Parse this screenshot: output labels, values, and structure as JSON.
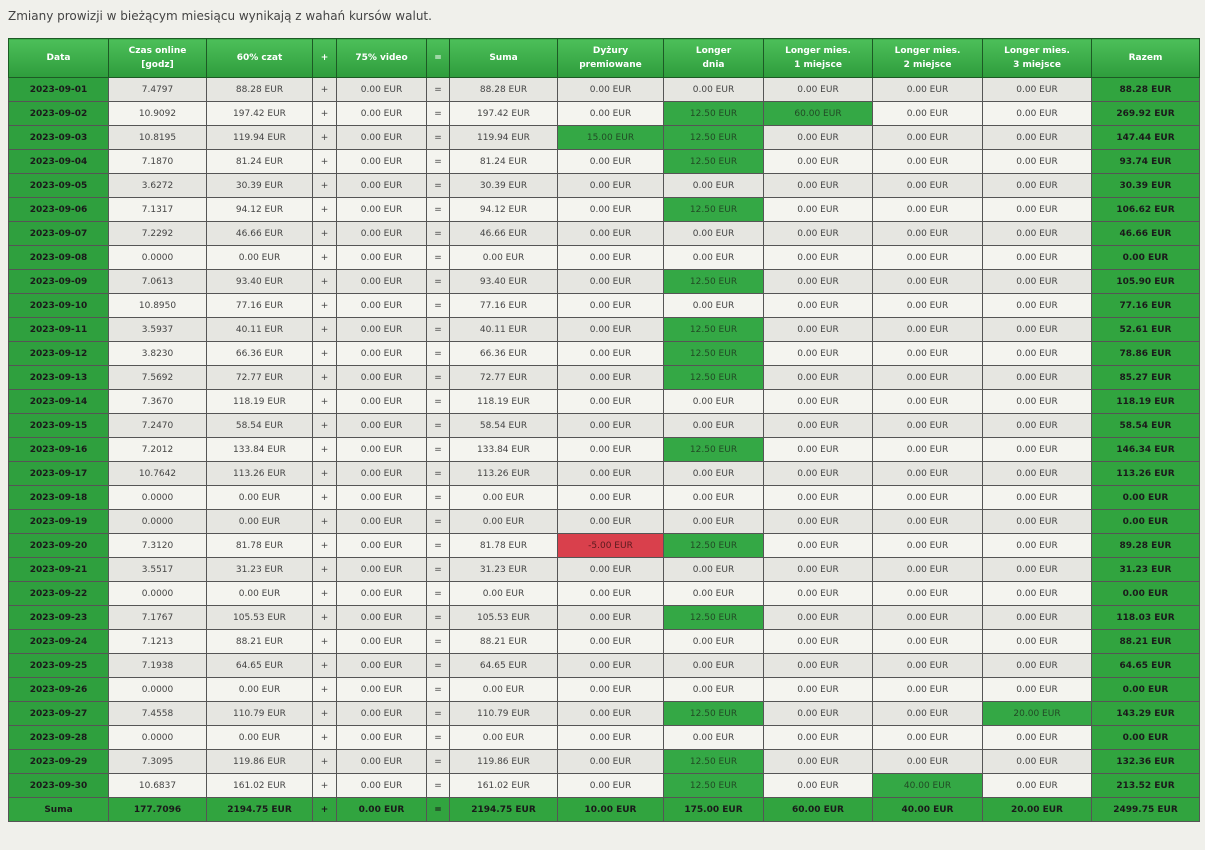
{
  "notice": "Zmiany prowizji w bieżącym miesiącu wynikają z wahań kursów walut.",
  "headers": [
    [
      "Data"
    ],
    [
      "Czas online",
      "[godz]"
    ],
    [
      "60% czat"
    ],
    [
      "+"
    ],
    [
      "75% video"
    ],
    [
      "="
    ],
    [
      "Suma"
    ],
    [
      "Dyżury",
      "premiowane"
    ],
    [
      "Longer",
      "dnia"
    ],
    [
      "Longer mies.",
      "1 miejsce"
    ],
    [
      "Longer mies.",
      "2 miejsce"
    ],
    [
      "Longer mies.",
      "3 miejsce"
    ],
    [
      "Razem"
    ]
  ],
  "rows": [
    [
      "2023-09-01",
      "7.4797",
      "88.28 EUR",
      "+",
      "0.00 EUR",
      "=",
      "88.28 EUR",
      "0.00 EUR",
      "0.00 EUR",
      "0.00 EUR",
      "0.00 EUR",
      "0.00 EUR",
      "88.28 EUR"
    ],
    [
      "2023-09-02",
      "10.9092",
      "197.42 EUR",
      "+",
      "0.00 EUR",
      "=",
      "197.42 EUR",
      "0.00 EUR",
      "12.50 EUR",
      "60.00 EUR",
      "0.00 EUR",
      "0.00 EUR",
      "269.92 EUR"
    ],
    [
      "2023-09-03",
      "10.8195",
      "119.94 EUR",
      "+",
      "0.00 EUR",
      "=",
      "119.94 EUR",
      "15.00 EUR",
      "12.50 EUR",
      "0.00 EUR",
      "0.00 EUR",
      "0.00 EUR",
      "147.44 EUR"
    ],
    [
      "2023-09-04",
      "7.1870",
      "81.24 EUR",
      "+",
      "0.00 EUR",
      "=",
      "81.24 EUR",
      "0.00 EUR",
      "12.50 EUR",
      "0.00 EUR",
      "0.00 EUR",
      "0.00 EUR",
      "93.74 EUR"
    ],
    [
      "2023-09-05",
      "3.6272",
      "30.39 EUR",
      "+",
      "0.00 EUR",
      "=",
      "30.39 EUR",
      "0.00 EUR",
      "0.00 EUR",
      "0.00 EUR",
      "0.00 EUR",
      "0.00 EUR",
      "30.39 EUR"
    ],
    [
      "2023-09-06",
      "7.1317",
      "94.12 EUR",
      "+",
      "0.00 EUR",
      "=",
      "94.12 EUR",
      "0.00 EUR",
      "12.50 EUR",
      "0.00 EUR",
      "0.00 EUR",
      "0.00 EUR",
      "106.62 EUR"
    ],
    [
      "2023-09-07",
      "7.2292",
      "46.66 EUR",
      "+",
      "0.00 EUR",
      "=",
      "46.66 EUR",
      "0.00 EUR",
      "0.00 EUR",
      "0.00 EUR",
      "0.00 EUR",
      "0.00 EUR",
      "46.66 EUR"
    ],
    [
      "2023-09-08",
      "0.0000",
      "0.00 EUR",
      "+",
      "0.00 EUR",
      "=",
      "0.00 EUR",
      "0.00 EUR",
      "0.00 EUR",
      "0.00 EUR",
      "0.00 EUR",
      "0.00 EUR",
      "0.00 EUR"
    ],
    [
      "2023-09-09",
      "7.0613",
      "93.40 EUR",
      "+",
      "0.00 EUR",
      "=",
      "93.40 EUR",
      "0.00 EUR",
      "12.50 EUR",
      "0.00 EUR",
      "0.00 EUR",
      "0.00 EUR",
      "105.90 EUR"
    ],
    [
      "2023-09-10",
      "10.8950",
      "77.16 EUR",
      "+",
      "0.00 EUR",
      "=",
      "77.16 EUR",
      "0.00 EUR",
      "0.00 EUR",
      "0.00 EUR",
      "0.00 EUR",
      "0.00 EUR",
      "77.16 EUR"
    ],
    [
      "2023-09-11",
      "3.5937",
      "40.11 EUR",
      "+",
      "0.00 EUR",
      "=",
      "40.11 EUR",
      "0.00 EUR",
      "12.50 EUR",
      "0.00 EUR",
      "0.00 EUR",
      "0.00 EUR",
      "52.61 EUR"
    ],
    [
      "2023-09-12",
      "3.8230",
      "66.36 EUR",
      "+",
      "0.00 EUR",
      "=",
      "66.36 EUR",
      "0.00 EUR",
      "12.50 EUR",
      "0.00 EUR",
      "0.00 EUR",
      "0.00 EUR",
      "78.86 EUR"
    ],
    [
      "2023-09-13",
      "7.5692",
      "72.77 EUR",
      "+",
      "0.00 EUR",
      "=",
      "72.77 EUR",
      "0.00 EUR",
      "12.50 EUR",
      "0.00 EUR",
      "0.00 EUR",
      "0.00 EUR",
      "85.27 EUR"
    ],
    [
      "2023-09-14",
      "7.3670",
      "118.19 EUR",
      "+",
      "0.00 EUR",
      "=",
      "118.19 EUR",
      "0.00 EUR",
      "0.00 EUR",
      "0.00 EUR",
      "0.00 EUR",
      "0.00 EUR",
      "118.19 EUR"
    ],
    [
      "2023-09-15",
      "7.2470",
      "58.54 EUR",
      "+",
      "0.00 EUR",
      "=",
      "58.54 EUR",
      "0.00 EUR",
      "0.00 EUR",
      "0.00 EUR",
      "0.00 EUR",
      "0.00 EUR",
      "58.54 EUR"
    ],
    [
      "2023-09-16",
      "7.2012",
      "133.84 EUR",
      "+",
      "0.00 EUR",
      "=",
      "133.84 EUR",
      "0.00 EUR",
      "12.50 EUR",
      "0.00 EUR",
      "0.00 EUR",
      "0.00 EUR",
      "146.34 EUR"
    ],
    [
      "2023-09-17",
      "10.7642",
      "113.26 EUR",
      "+",
      "0.00 EUR",
      "=",
      "113.26 EUR",
      "0.00 EUR",
      "0.00 EUR",
      "0.00 EUR",
      "0.00 EUR",
      "0.00 EUR",
      "113.26 EUR"
    ],
    [
      "2023-09-18",
      "0.0000",
      "0.00 EUR",
      "+",
      "0.00 EUR",
      "=",
      "0.00 EUR",
      "0.00 EUR",
      "0.00 EUR",
      "0.00 EUR",
      "0.00 EUR",
      "0.00 EUR",
      "0.00 EUR"
    ],
    [
      "2023-09-19",
      "0.0000",
      "0.00 EUR",
      "+",
      "0.00 EUR",
      "=",
      "0.00 EUR",
      "0.00 EUR",
      "0.00 EUR",
      "0.00 EUR",
      "0.00 EUR",
      "0.00 EUR",
      "0.00 EUR"
    ],
    [
      "2023-09-20",
      "7.3120",
      "81.78 EUR",
      "+",
      "0.00 EUR",
      "=",
      "81.78 EUR",
      "-5.00 EUR",
      "12.50 EUR",
      "0.00 EUR",
      "0.00 EUR",
      "0.00 EUR",
      "89.28 EUR"
    ],
    [
      "2023-09-21",
      "3.5517",
      "31.23 EUR",
      "+",
      "0.00 EUR",
      "=",
      "31.23 EUR",
      "0.00 EUR",
      "0.00 EUR",
      "0.00 EUR",
      "0.00 EUR",
      "0.00 EUR",
      "31.23 EUR"
    ],
    [
      "2023-09-22",
      "0.0000",
      "0.00 EUR",
      "+",
      "0.00 EUR",
      "=",
      "0.00 EUR",
      "0.00 EUR",
      "0.00 EUR",
      "0.00 EUR",
      "0.00 EUR",
      "0.00 EUR",
      "0.00 EUR"
    ],
    [
      "2023-09-23",
      "7.1767",
      "105.53 EUR",
      "+",
      "0.00 EUR",
      "=",
      "105.53 EUR",
      "0.00 EUR",
      "12.50 EUR",
      "0.00 EUR",
      "0.00 EUR",
      "0.00 EUR",
      "118.03 EUR"
    ],
    [
      "2023-09-24",
      "7.1213",
      "88.21 EUR",
      "+",
      "0.00 EUR",
      "=",
      "88.21 EUR",
      "0.00 EUR",
      "0.00 EUR",
      "0.00 EUR",
      "0.00 EUR",
      "0.00 EUR",
      "88.21 EUR"
    ],
    [
      "2023-09-25",
      "7.1938",
      "64.65 EUR",
      "+",
      "0.00 EUR",
      "=",
      "64.65 EUR",
      "0.00 EUR",
      "0.00 EUR",
      "0.00 EUR",
      "0.00 EUR",
      "0.00 EUR",
      "64.65 EUR"
    ],
    [
      "2023-09-26",
      "0.0000",
      "0.00 EUR",
      "+",
      "0.00 EUR",
      "=",
      "0.00 EUR",
      "0.00 EUR",
      "0.00 EUR",
      "0.00 EUR",
      "0.00 EUR",
      "0.00 EUR",
      "0.00 EUR"
    ],
    [
      "2023-09-27",
      "7.4558",
      "110.79 EUR",
      "+",
      "0.00 EUR",
      "=",
      "110.79 EUR",
      "0.00 EUR",
      "12.50 EUR",
      "0.00 EUR",
      "0.00 EUR",
      "20.00 EUR",
      "143.29 EUR"
    ],
    [
      "2023-09-28",
      "0.0000",
      "0.00 EUR",
      "+",
      "0.00 EUR",
      "=",
      "0.00 EUR",
      "0.00 EUR",
      "0.00 EUR",
      "0.00 EUR",
      "0.00 EUR",
      "0.00 EUR",
      "0.00 EUR"
    ],
    [
      "2023-09-29",
      "7.3095",
      "119.86 EUR",
      "+",
      "0.00 EUR",
      "=",
      "119.86 EUR",
      "0.00 EUR",
      "12.50 EUR",
      "0.00 EUR",
      "0.00 EUR",
      "0.00 EUR",
      "132.36 EUR"
    ],
    [
      "2023-09-30",
      "10.6837",
      "161.02 EUR",
      "+",
      "0.00 EUR",
      "=",
      "161.02 EUR",
      "0.00 EUR",
      "12.50 EUR",
      "0.00 EUR",
      "40.00 EUR",
      "0.00 EUR",
      "213.52 EUR"
    ]
  ],
  "total": [
    "Suma",
    "177.7096",
    "2194.75 EUR",
    "+",
    "0.00 EUR",
    "=",
    "2194.75 EUR",
    "10.00 EUR",
    "175.00 EUR",
    "60.00 EUR",
    "40.00 EUR",
    "20.00 EUR",
    "2499.75 EUR"
  ],
  "colors": {
    "header_green": "#3fb24c",
    "highlight_green": "#34a845",
    "penalty_red": "#d9404c",
    "background": "#f0f0eb"
  }
}
